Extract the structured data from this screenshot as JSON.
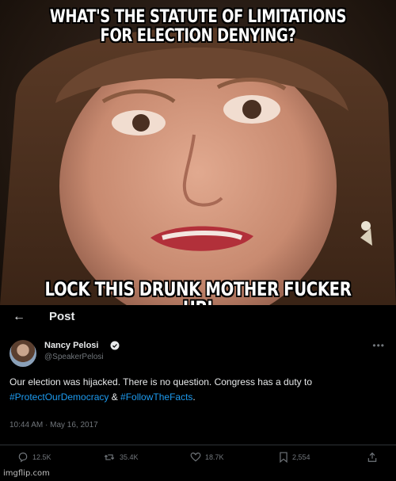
{
  "meme": {
    "top_caption": "WHAT'S THE STATUTE OF LIMITATIONS FOR ELECTION DENYING?",
    "bottom_caption": "LOCK THIS DRUNK MOTHER FUCKER UP!"
  },
  "tweet": {
    "header_title": "Post",
    "back_icon": "arrow-left-icon",
    "author": {
      "name": "Nancy Pelosi",
      "handle": "@SpeakerPelosi",
      "verified_icon": "verified-badge-icon"
    },
    "body": {
      "text_1": "Our election was hijacked. There is no question. Congress has a duty to",
      "hashtag_1": "#ProtectOurDemocracy",
      "connector": " & ",
      "hashtag_2": "#FollowTheFacts",
      "end": "."
    },
    "timestamp": "10:44 AM · May 16, 2017",
    "actions": {
      "replies": "12.5K",
      "reposts": "35.4K",
      "likes": "18.7K",
      "bookmarks": "2,554"
    },
    "colors": {
      "background": "#000000",
      "text": "#e7e9ea",
      "muted": "#71767b",
      "link": "#1d9bf0"
    }
  },
  "watermark": "imgflip.com"
}
